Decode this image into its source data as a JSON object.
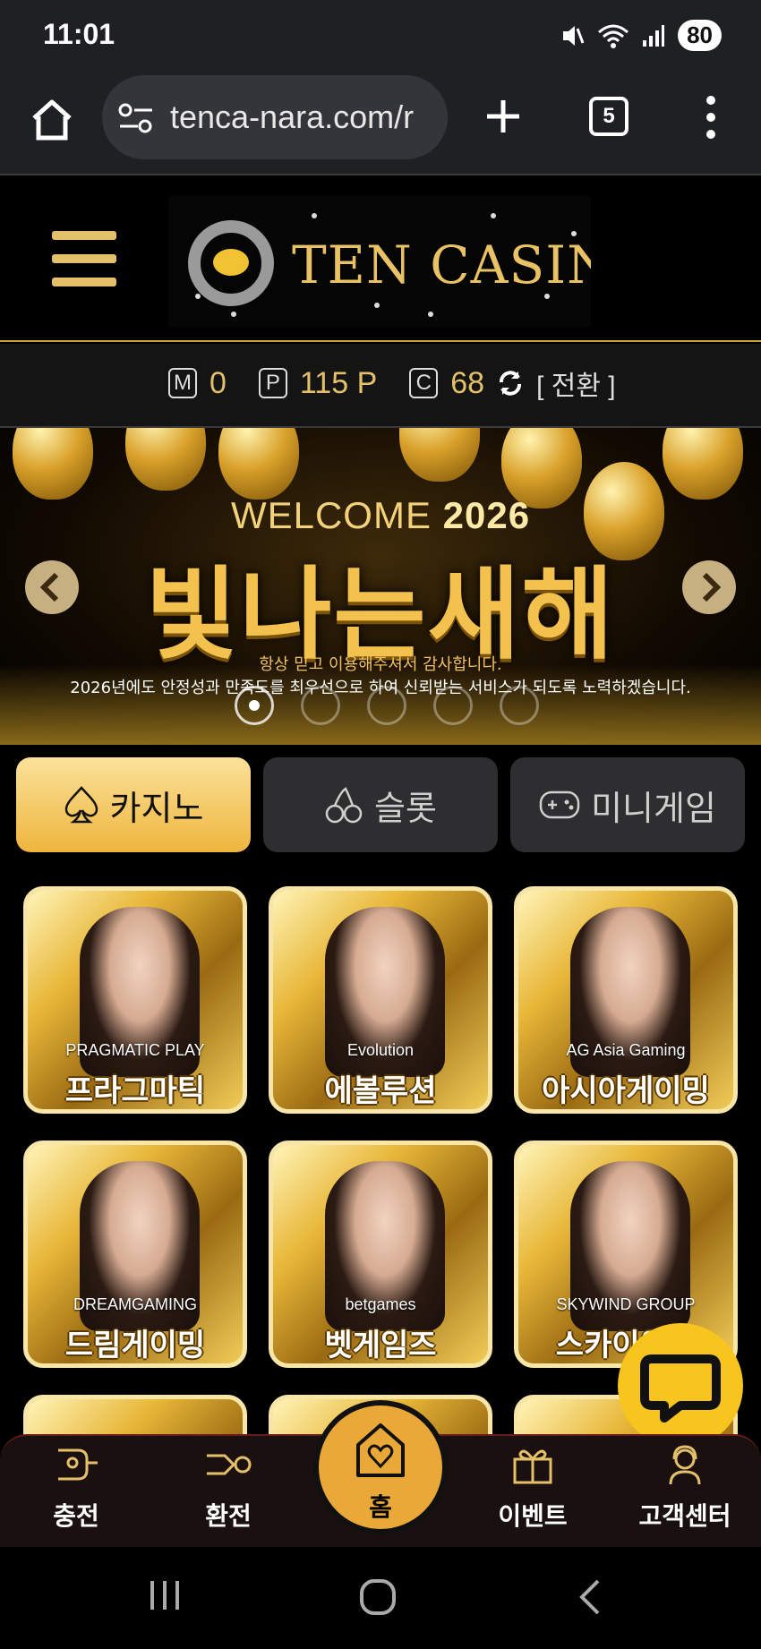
{
  "status_bar": {
    "time": "11:01",
    "battery": "80"
  },
  "browser": {
    "url": "tenca-nara.com/r",
    "tab_count": "5"
  },
  "site": {
    "logo_text": "TEN CASINO",
    "balance": {
      "m_badge": "M",
      "m_value": "0",
      "p_badge": "P",
      "p_value": "115 P",
      "c_badge": "C",
      "c_value": "68",
      "switch_label": "[ 전환 ]"
    }
  },
  "banner": {
    "welcome_prefix": "WELCOME",
    "year": "2026",
    "headline": "빛나는새해",
    "sub1": "항상 믿고 이용해주셔서 감사합니다.",
    "sub2": "2026년에도 안정성과 만족도를 최우선으로 하여 신뢰받는 서비스가 되도록 노력하겠습니다."
  },
  "category_tabs": [
    {
      "label": "카지노",
      "icon": "spade-icon",
      "active": true
    },
    {
      "label": "슬롯",
      "icon": "cherry-icon",
      "active": false
    },
    {
      "label": "미니게임",
      "icon": "gamepad-icon",
      "active": false
    }
  ],
  "games": [
    {
      "label": "프라그마틱",
      "provider": "PRAGMATIC PLAY"
    },
    {
      "label": "에볼루션",
      "provider": "Evolution"
    },
    {
      "label": "아시아게이밍",
      "provider": "AG Asia Gaming"
    },
    {
      "label": "드림게이밍",
      "provider": "DREAMGAMING"
    },
    {
      "label": "벳게임즈",
      "provider": "betgames"
    },
    {
      "label": "스카이윈드",
      "provider": "SKYWIND GROUP"
    }
  ],
  "bottom_nav": {
    "charge": "충전",
    "exchange": "환전",
    "home": "홈",
    "event": "이벤트",
    "support": "고객센터"
  },
  "colors": {
    "gold": "#e5c06a",
    "accent": "#efb53d",
    "fab": "#f7c51e"
  }
}
